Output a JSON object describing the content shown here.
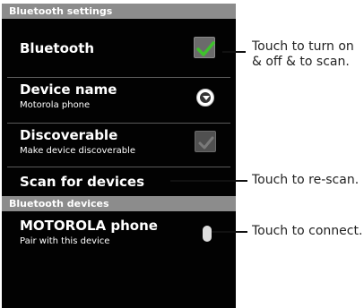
{
  "section_settings": "Bluetooth settings",
  "bluetooth": {
    "title": "Bluetooth",
    "checked": true
  },
  "device_name": {
    "title": "Device name",
    "subtitle": "Motorola phone"
  },
  "discoverable": {
    "title": "Discoverable",
    "subtitle": "Make device discoverable",
    "checked": false
  },
  "scan": {
    "title": "Scan for devices"
  },
  "section_devices": "Bluetooth devices",
  "device": {
    "title": "MOTOROLA phone",
    "subtitle": "Pair with this device"
  },
  "callouts": {
    "bluetooth_line1": "Touch  to turn on",
    "bluetooth_line2": "& off & to scan.",
    "scan": "Touch to re-scan.",
    "device": "Touch to connect."
  },
  "colors": {
    "check_green": "#3ec22c",
    "section_bg": "#8c8c8c",
    "screen_bg": "#020202"
  }
}
